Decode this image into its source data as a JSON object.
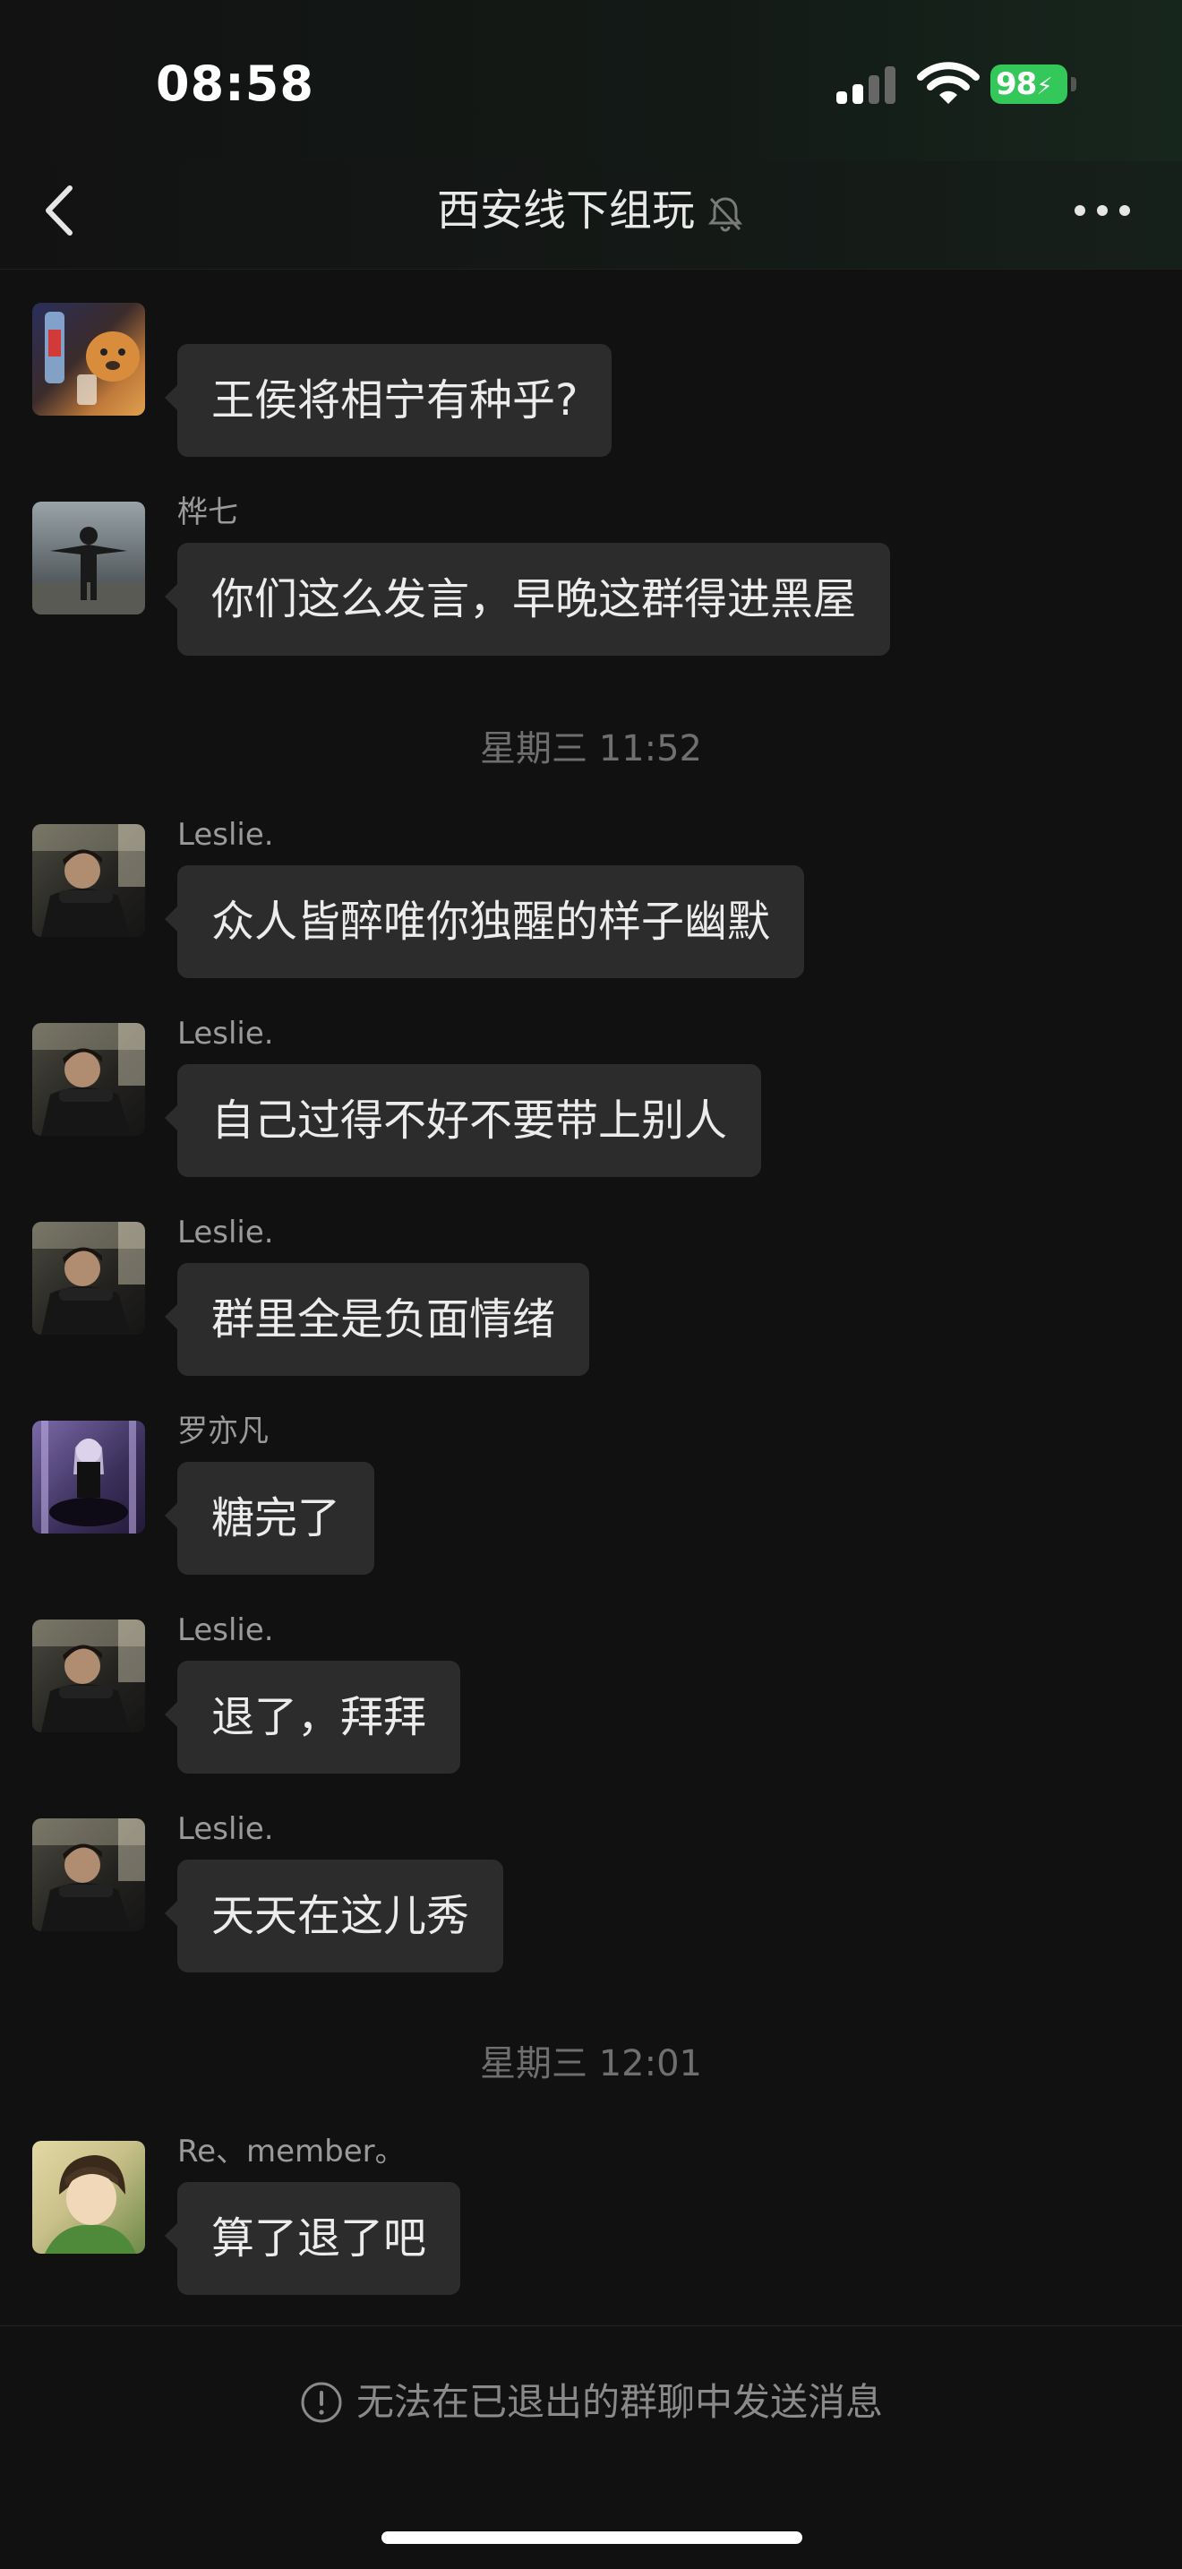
{
  "status_bar": {
    "time": "08:58",
    "battery": "98"
  },
  "header": {
    "title": "西安线下组玩"
  },
  "messages": [
    {
      "sender": "",
      "text": "王侯将相宁有种乎?"
    },
    {
      "sender": "桦七",
      "text": "你们这么发言，早晚这群得进黑屋"
    },
    {
      "sender": "Leslie.",
      "text": "众人皆醉唯你独醒的样子幽默"
    },
    {
      "sender": "Leslie.",
      "text": "自己过得不好不要带上别人"
    },
    {
      "sender": "Leslie.",
      "text": "群里全是负面情绪"
    },
    {
      "sender": "罗亦凡",
      "text": "糖完了"
    },
    {
      "sender": "Leslie.",
      "text": "退了，拜拜"
    },
    {
      "sender": "Leslie.",
      "text": "天天在这儿秀"
    },
    {
      "sender": "Re、member。",
      "text": "算了退了吧"
    }
  ],
  "timestamps": [
    "星期三 11:52",
    "星期三 12:01"
  ],
  "footer": {
    "notice": "无法在已退出的群聊中发送消息"
  },
  "colors": {
    "background": "#111111",
    "bubble": "#2c2c2c",
    "battery": "#34c759"
  },
  "icons": [
    "back-chevron-icon",
    "mute-bell-icon",
    "more-dots-icon",
    "info-circle-icon",
    "wifi-icon",
    "signal-icon"
  ]
}
